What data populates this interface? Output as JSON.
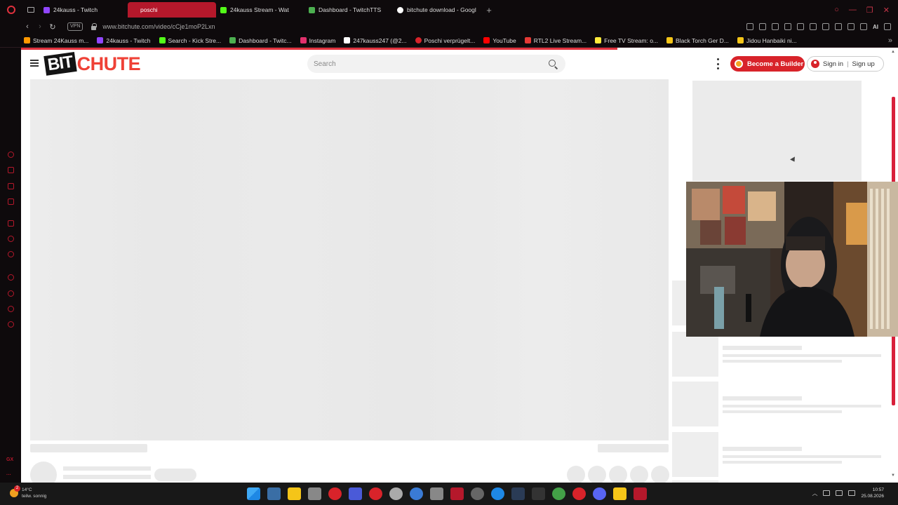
{
  "browser": {
    "tabs": [
      {
        "label": "24kauss - Twitch",
        "icon_color": "#9146ff",
        "active": false
      },
      {
        "label": "poschi",
        "icon_color": "#9146ff",
        "active": true
      },
      {
        "label": "24kauss Stream - Wat",
        "icon_color": "#53fc18",
        "active": false
      },
      {
        "label": "Dashboard - TwitchTTS",
        "icon_color": "#4caf50",
        "active": false
      },
      {
        "label": "bitchute download - Googl",
        "icon_color": "#ffffff",
        "active": false
      }
    ],
    "new_tab_symbol": "+",
    "address": {
      "vpn_label": "VPN",
      "url": "www.bitchute.com/video/cCje1moP2Lxn",
      "ai_label": "AI"
    },
    "bookmarks": [
      {
        "label": "Stream 24Kauss m...",
        "icon_color": "#ff9800"
      },
      {
        "label": "24kauss - Twitch",
        "icon_color": "#9146ff"
      },
      {
        "label": "Search - Kick Stre...",
        "icon_color": "#53fc18"
      },
      {
        "label": "Dashboard - Twitc...",
        "icon_color": "#4caf50"
      },
      {
        "label": "Instagram",
        "icon_color": "#e1306c"
      },
      {
        "label": "247kauss247 (@2...",
        "icon_color": "#ffffff"
      },
      {
        "label": "Poschi verprügelt...",
        "icon_color": "#d8232a"
      },
      {
        "label": "YouTube",
        "icon_color": "#ff0000"
      },
      {
        "label": "RTL2 Live Stream...",
        "icon_color": "#e53935"
      },
      {
        "label": "Free TV Stream: o...",
        "icon_color": "#ffeb3b"
      },
      {
        "label": "Black Torch Ger D...",
        "icon_color": "#f5c518"
      },
      {
        "label": "Jidou Hanbaiki ni...",
        "icon_color": "#f5c518"
      }
    ],
    "bookmarks_more": "»"
  },
  "bitchute": {
    "logo_bit": "BIT",
    "logo_chute": "CHUTE",
    "search_placeholder": "Search",
    "become_builder": "Become a Builder",
    "sign_in": "Sign in",
    "separator": "|",
    "sign_up": "Sign up",
    "accent": "#d8232a"
  },
  "taskbar": {
    "weather_temp": "14°C",
    "weather_desc": "teilw. sonnig",
    "notification_count": "2",
    "time": "10:57",
    "date": "25.08.2026"
  }
}
